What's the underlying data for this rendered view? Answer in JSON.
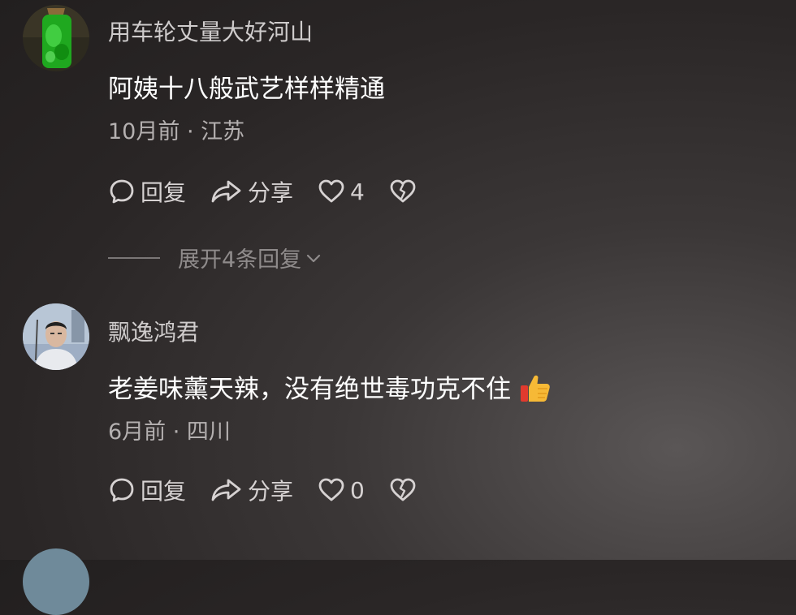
{
  "comments": [
    {
      "username": "用车轮丈量大好河山",
      "text": "阿姨十八般武艺样样精通",
      "meta": "10月前 · 江苏",
      "reply_label": "回复",
      "share_label": "分享",
      "like_count": "4"
    },
    {
      "username": "飘逸鸿君",
      "text": "老姜味薰天辣，没有绝世毒功克不住",
      "emoji": "thumbs-up",
      "meta": "6月前 · 四川",
      "reply_label": "回复",
      "share_label": "分享",
      "like_count": "0"
    }
  ],
  "expand_replies": "展开4条回复",
  "icons": {
    "reply": "speech-bubble-icon",
    "share": "share-arrow-icon",
    "like": "heart-icon",
    "dislike": "broken-heart-icon",
    "expand": "chevron-down-icon"
  }
}
